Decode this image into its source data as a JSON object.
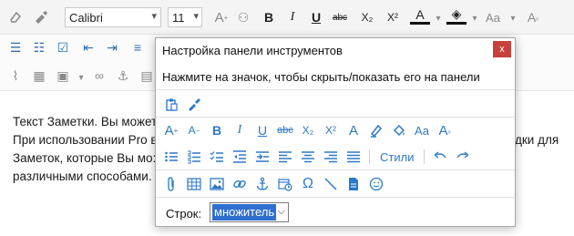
{
  "editor": {
    "font_name": "Calibri",
    "font_size": "11",
    "note_lines": [
      "Текст Заметки. Вы может",
      "При использовании Pro в",
      "Заметок, которые Вы мо:",
      "различными способами."
    ],
    "note_right_fragment": "дки для"
  },
  "dialog": {
    "title": "Настройка панели инструментов",
    "close_glyph": "x",
    "hint": "Нажмите на значок, чтобы скрыть/показать его на панели",
    "styles_label": "Стили",
    "rows_label": "Строк:",
    "rows_value": "множитель"
  },
  "icons": {
    "bold": "B",
    "italic": "I",
    "underline": "U",
    "strike": "abc",
    "subscript": "X₂",
    "superscript": "X²",
    "font_color": "A",
    "font_size_up": "A",
    "font_size_down": "A",
    "aa": "Aa",
    "omega": "Ω"
  },
  "colors": {
    "accent": "#2d79c7",
    "close_button": "#c7403a",
    "selection": "#2f6fd0"
  }
}
